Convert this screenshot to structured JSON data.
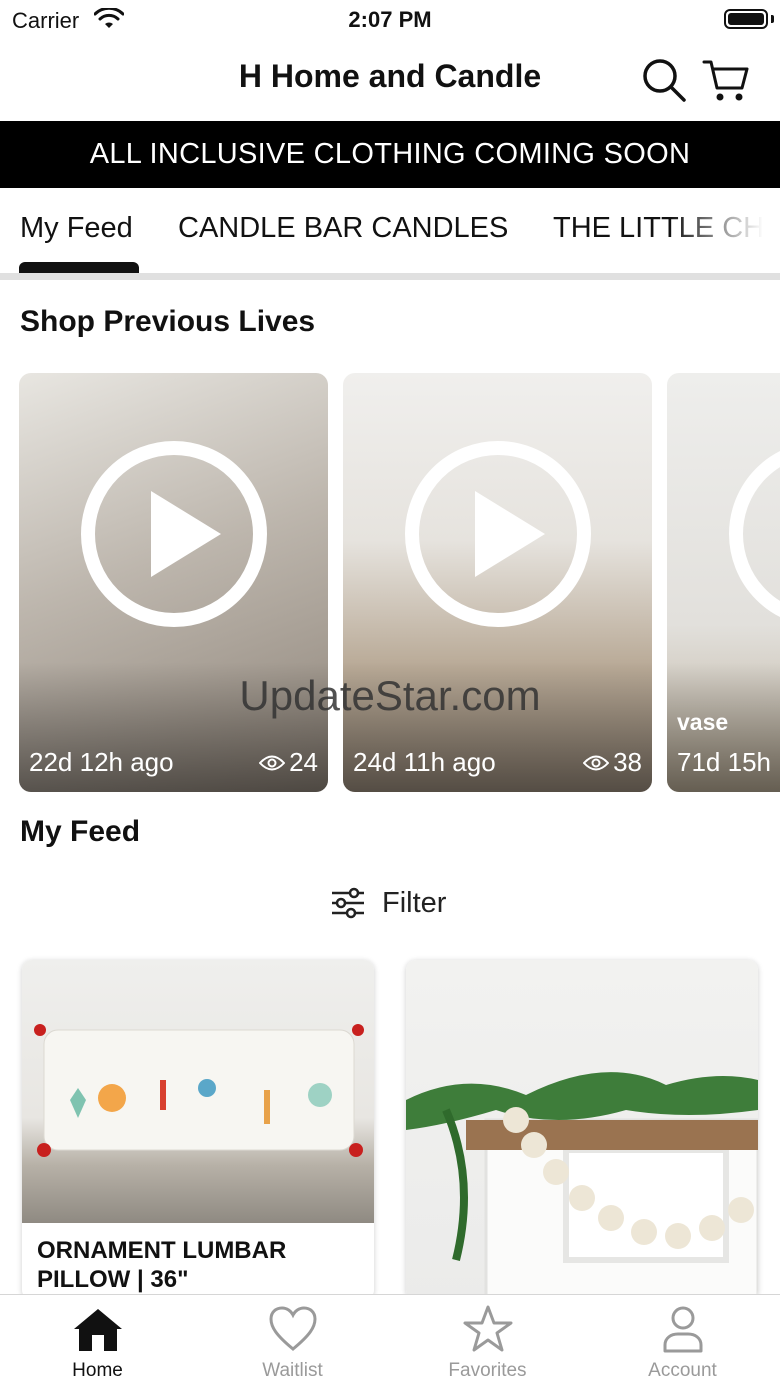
{
  "status": {
    "carrier": "Carrier",
    "time": "2:07 PM"
  },
  "header": {
    "title": "H Home and Candle",
    "search_icon": "search-icon",
    "cart_icon": "cart-icon"
  },
  "announcement": "ALL INCLUSIVE CLOTHING COMING SOON",
  "tabs": [
    {
      "label": "My Feed",
      "active": true
    },
    {
      "label": "CANDLE BAR CANDLES",
      "active": false
    },
    {
      "label": "THE LITTLE CH",
      "active": false
    }
  ],
  "previous_lives": {
    "title": "Shop Previous Lives",
    "items": [
      {
        "label": "",
        "ago": "22d 12h ago",
        "views": "24"
      },
      {
        "label": "",
        "ago": "24d 11h ago",
        "views": "38"
      },
      {
        "label": "vase",
        "ago": "71d 15h",
        "views": ""
      }
    ]
  },
  "watermark": "UpdateStar.com",
  "feed": {
    "title": "My Feed",
    "filter_label": "Filter",
    "products": [
      {
        "name": "ORNAMENT LUMBAR PILLOW | 36\""
      },
      {
        "name": ""
      }
    ]
  },
  "tab_bar": [
    {
      "label": "Home",
      "icon": "home-icon",
      "active": true
    },
    {
      "label": "Waitlist",
      "icon": "heart-icon",
      "active": false
    },
    {
      "label": "Favorites",
      "icon": "star-icon",
      "active": false
    },
    {
      "label": "Account",
      "icon": "person-icon",
      "active": false
    }
  ],
  "colors": {
    "banner_bg": "#000000",
    "active_text": "#111111",
    "inactive_text": "#9a9a9a"
  }
}
